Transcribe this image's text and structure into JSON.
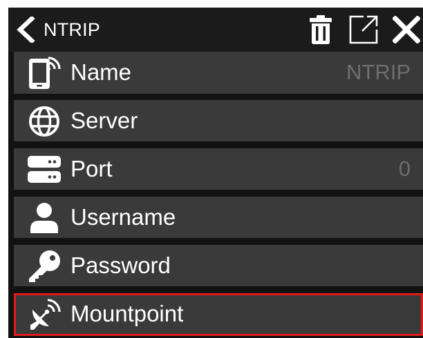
{
  "header": {
    "title": "NTRIP",
    "back_icon": "chevron-left-icon",
    "actions": [
      {
        "name": "delete",
        "icon": "trash-icon"
      },
      {
        "name": "open-external",
        "icon": "open-external-icon"
      },
      {
        "name": "close",
        "icon": "close-icon"
      }
    ]
  },
  "fields": [
    {
      "label": "Name",
      "value": "NTRIP",
      "icon": "device-signal-icon"
    },
    {
      "label": "Server",
      "value": "",
      "icon": "globe-icon"
    },
    {
      "label": "Port",
      "value": "0",
      "icon": "server-icon"
    },
    {
      "label": "Username",
      "value": "",
      "icon": "user-icon"
    },
    {
      "label": "Password",
      "value": "",
      "icon": "key-icon"
    },
    {
      "label": "Mountpoint",
      "value": "",
      "icon": "satellite-dish-icon",
      "selected": true
    }
  ],
  "colors": {
    "background": "#121212",
    "header": "#1b1b1b",
    "row": "#3a3a3a",
    "text": "#ffffff",
    "value_text": "#6e6e6e",
    "selection_outline": "#e01a1a"
  }
}
